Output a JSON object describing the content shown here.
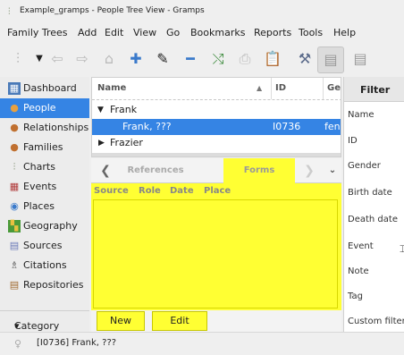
{
  "window": {
    "title": "Example_gramps - People Tree View - Gramps"
  },
  "menu": [
    "Family Trees",
    "Add",
    "Edit",
    "View",
    "Go",
    "Bookmarks",
    "Reports",
    "Tools",
    "Help"
  ],
  "toolbar_icons": [
    "tree-icon",
    "dropdown-arrow-icon",
    "back-icon",
    "forward-icon",
    "home-icon",
    "add-icon",
    "edit-icon",
    "remove-icon",
    "merge-icon",
    "print-icon",
    "clipboard-icon",
    "tools-icon",
    "sidebar-toggle-icon",
    "bottombar-toggle-icon"
  ],
  "sidebar": {
    "items": [
      {
        "label": "Dashboard",
        "icon": "dashboard-icon"
      },
      {
        "label": "People",
        "icon": "people-icon"
      },
      {
        "label": "Relationships",
        "icon": "relationships-icon"
      },
      {
        "label": "Families",
        "icon": "families-icon"
      },
      {
        "label": "Charts",
        "icon": "charts-icon"
      },
      {
        "label": "Events",
        "icon": "events-icon"
      },
      {
        "label": "Places",
        "icon": "places-icon"
      },
      {
        "label": "Geography",
        "icon": "geography-icon"
      },
      {
        "label": "Sources",
        "icon": "sources-icon"
      },
      {
        "label": "Citations",
        "icon": "citations-icon"
      },
      {
        "label": "Repositories",
        "icon": "repositories-icon"
      }
    ],
    "category_label": "Category"
  },
  "people_list": {
    "columns": [
      "Name",
      "ID",
      "Ge"
    ],
    "rows": [
      {
        "name": "Frank",
        "id": "",
        "gender": "",
        "expanded": true
      },
      {
        "name": "Frank, ???",
        "id": "I0736",
        "gender": "fen",
        "selected": true
      },
      {
        "name": "Frazier",
        "id": "",
        "gender": "",
        "expanded": false
      }
    ]
  },
  "bottombar": {
    "tabs": [
      "References",
      "Forms"
    ],
    "active_tab": "Forms",
    "form_columns": [
      "Source",
      "Role",
      "Date",
      "Place"
    ],
    "buttons": {
      "new": "New",
      "edit": "Edit"
    }
  },
  "filter": {
    "tab_label": "Filter",
    "fields": [
      "Name",
      "ID",
      "Gender",
      "Birth date",
      "Death date",
      "Event",
      "Note",
      "Tag",
      "Custom filter"
    ]
  },
  "status": {
    "text": "[I0736] Frank, ???"
  },
  "colors": {
    "selection": "#3584e4",
    "gramplet_yellow": "#ffff33"
  }
}
